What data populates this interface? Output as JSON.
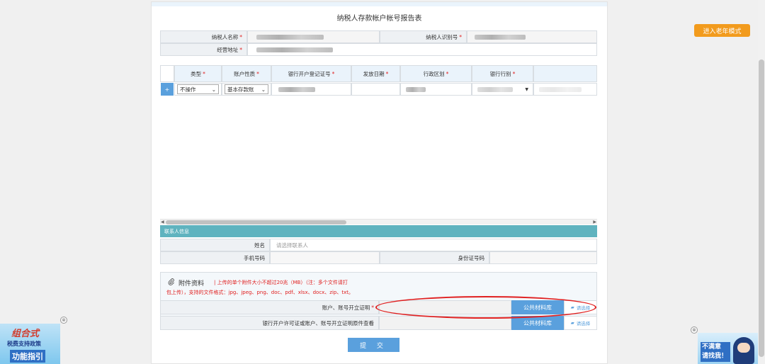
{
  "form": {
    "title": "纳税人存款帐户帐号报告表",
    "taxpayer_name_label": "纳税人名称",
    "taxpayer_id_label": "纳税人识别号",
    "address_label": "经营地址",
    "required_mark": "*"
  },
  "grid": {
    "headers": [
      "类型",
      "账户性质",
      "银行开户登记证号",
      "发放日期",
      "行政区划",
      "银行行别"
    ],
    "row": {
      "add_button": "+",
      "type_value": "不操作",
      "nature_value": "基本存款账"
    }
  },
  "contact": {
    "section_label": "联系人信息",
    "name_label": "姓名",
    "name_placeholder": "请选择联系人",
    "phone_label": "手机号码",
    "id_label": "身份证号码"
  },
  "attachments": {
    "title": "附件资料",
    "note_line1": "| 上传的单个附件大小不超过20兆（MB）（注：多个文件请打",
    "note_line2": "包上传），支持的文件格式：jpg、jpeg、png、doc、pdf、xlsx、docx、zip、txt。",
    "row1_label": "账户、账号开立证明",
    "row2_label": "银行开户许可证或账户、账号开立证明原件查看",
    "library_button": "公共材料库",
    "choose_button": "请选择"
  },
  "submit_label": "提 交",
  "elder_mode_button": "进入老年模式",
  "ad_left": {
    "line1": "组合式",
    "line2": "税费支持政策",
    "line3": "功能指引"
  },
  "ad_right": {
    "line1": "不满意",
    "line2": "请找我！"
  },
  "close_glyph": "⊗",
  "colors": {
    "accent": "#5aa0dd",
    "section": "#5fb3bf",
    "required": "#e02020",
    "elder": "#f29b1d"
  }
}
